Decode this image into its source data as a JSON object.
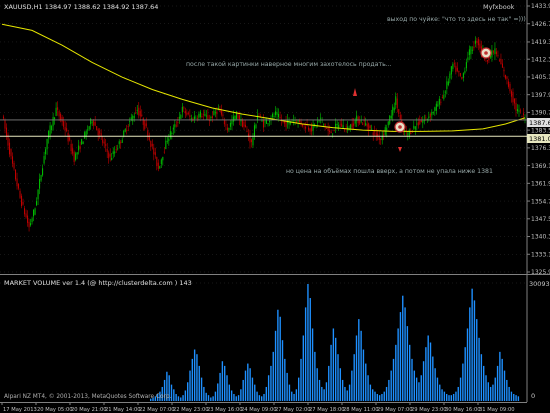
{
  "chart": {
    "title": "XAUUSD,H1  1384.97 1388.62 1384.92 1387.64",
    "brand": "Myfxbook",
    "price_ticks": [
      "1433.90",
      "1426.70",
      "1419.30",
      "1412.30",
      "1405.10",
      "1397.90",
      "1390.70",
      "1383.50",
      "1376.30",
      "1369.10",
      "1361.90",
      "1354.70",
      "1347.50",
      "1340.30",
      "1333.10",
      "1325.90"
    ],
    "current_price": "1387.64",
    "level_price": "1381.00",
    "annotations": {
      "top_right": "выход по чуйке: \"что то здесь не так\" =)))",
      "middle": "после такой картинки наверное многим захотелось продать...",
      "bottom": "но цена на объёмах пошла вверх, а потом не упала ниже 1381"
    },
    "colors": {
      "bull": "#00c000",
      "bear": "#c00000",
      "ma": "#e6e600",
      "level": "#e8e8c0",
      "volume": "#1e90ff",
      "background": "#000000",
      "grid": "#3a3a3a",
      "text": "#c0c0c0"
    }
  },
  "volume": {
    "title": "MARKET VOLUME ver 1.4 (@ http://clusterdelta.com ) 143",
    "max_label": "30093",
    "zero_label": "0",
    "footer": "Alpari NZ MT4, © 2001-2013, MetaQuotes Software Corp."
  },
  "time_axis": {
    "labels": [
      "17 May 2013",
      "20 May 05:00",
      "20 May 21:00",
      "21 May 14:00",
      "22 May 07:00",
      "22 May 23:00",
      "23 May 16:00",
      "24 May 09:00",
      "27 May 02:00",
      "27 May 18:00",
      "28 May 11:00",
      "29 May 07:00",
      "29 May 23:00",
      "30 May 16:00",
      "31 May 09:00"
    ]
  },
  "chart_data": {
    "type": "candlestick",
    "symbol": "XAUUSD",
    "timeframe": "H1",
    "ohlc_last": {
      "open": 1384.97,
      "high": 1388.62,
      "low": 1384.92,
      "close": 1387.64
    },
    "ylim": [
      1325.9,
      1433.9
    ],
    "close_path": [
      [
        0,
        1390
      ],
      [
        6,
        1372
      ],
      [
        12,
        1356
      ],
      [
        18,
        1344
      ],
      [
        22,
        1352
      ],
      [
        26,
        1366
      ],
      [
        30,
        1380
      ],
      [
        36,
        1392
      ],
      [
        42,
        1384
      ],
      [
        48,
        1372
      ],
      [
        54,
        1380
      ],
      [
        60,
        1388
      ],
      [
        66,
        1380
      ],
      [
        72,
        1372
      ],
      [
        78,
        1378
      ],
      [
        84,
        1386
      ],
      [
        90,
        1392
      ],
      [
        96,
        1384
      ],
      [
        100,
        1376
      ],
      [
        104,
        1368
      ],
      [
        110,
        1380
      ],
      [
        116,
        1386
      ],
      [
        120,
        1392
      ],
      [
        126,
        1388
      ],
      [
        132,
        1390
      ],
      [
        138,
        1388
      ],
      [
        144,
        1392
      ],
      [
        150,
        1384
      ],
      [
        156,
        1390
      ],
      [
        162,
        1384
      ],
      [
        166,
        1378
      ],
      [
        170,
        1390
      ],
      [
        174,
        1386
      ],
      [
        178,
        1388
      ],
      [
        182,
        1390
      ],
      [
        188,
        1386
      ],
      [
        194,
        1388
      ],
      [
        200,
        1386
      ],
      [
        206,
        1384
      ],
      [
        212,
        1388
      ],
      [
        218,
        1382
      ],
      [
        224,
        1386
      ],
      [
        230,
        1384
      ],
      [
        236,
        1388
      ],
      [
        242,
        1386
      ],
      [
        248,
        1382
      ],
      [
        252,
        1380
      ],
      [
        258,
        1388
      ],
      [
        262,
        1396
      ],
      [
        266,
        1384
      ],
      [
        270,
        1382
      ],
      [
        276,
        1386
      ],
      [
        282,
        1388
      ],
      [
        288,
        1392
      ],
      [
        294,
        1398
      ],
      [
        300,
        1410
      ],
      [
        306,
        1404
      ],
      [
        310,
        1414
      ],
      [
        316,
        1420
      ],
      [
        322,
        1412
      ],
      [
        328,
        1416
      ],
      [
        332,
        1410
      ],
      [
        338,
        1400
      ],
      [
        342,
        1392
      ],
      [
        348,
        1388
      ]
    ],
    "ma_path": [
      [
        0,
        1426.5
      ],
      [
        20,
        1424
      ],
      [
        40,
        1418
      ],
      [
        60,
        1411
      ],
      [
        80,
        1405
      ],
      [
        100,
        1400
      ],
      [
        120,
        1396
      ],
      [
        140,
        1392.5
      ],
      [
        160,
        1390
      ],
      [
        180,
        1388
      ],
      [
        200,
        1386
      ],
      [
        220,
        1384.5
      ],
      [
        240,
        1383.5
      ],
      [
        260,
        1383
      ],
      [
        280,
        1383
      ],
      [
        300,
        1383.2
      ],
      [
        320,
        1384
      ],
      [
        335,
        1386
      ],
      [
        348,
        1388.5
      ]
    ],
    "volume_values": [
      0.02,
      0.03,
      0.04,
      0.06,
      0.08,
      0.12,
      0.18,
      0.25,
      0.22,
      0.14,
      0.1,
      0.06,
      0.04,
      0.03,
      0.05,
      0.09,
      0.16,
      0.26,
      0.36,
      0.44,
      0.4,
      0.3,
      0.2,
      0.12,
      0.07,
      0.05,
      0.03,
      0.04,
      0.08,
      0.15,
      0.24,
      0.34,
      0.3,
      0.22,
      0.14,
      0.09,
      0.06,
      0.04,
      0.05,
      0.1,
      0.18,
      0.26,
      0.32,
      0.28,
      0.2,
      0.14,
      0.08,
      0.05,
      0.04,
      0.06,
      0.12,
      0.22,
      0.3,
      0.42,
      0.6,
      0.78,
      0.72,
      0.52,
      0.36,
      0.24,
      0.14,
      0.08,
      0.06,
      0.1,
      0.2,
      0.36,
      0.56,
      0.8,
      1.0,
      0.88,
      0.62,
      0.42,
      0.28,
      0.18,
      0.12,
      0.1,
      0.16,
      0.3,
      0.48,
      0.62,
      0.54,
      0.4,
      0.28,
      0.18,
      0.12,
      0.09,
      0.14,
      0.26,
      0.4,
      0.56,
      0.7,
      0.6,
      0.44,
      0.32,
      0.22,
      0.14,
      0.1,
      0.08,
      0.06,
      0.05,
      0.06,
      0.08,
      0.12,
      0.18,
      0.26,
      0.36,
      0.48,
      0.62,
      0.76,
      0.9,
      0.8,
      0.64,
      0.48,
      0.36,
      0.26,
      0.2,
      0.16,
      0.22,
      0.34,
      0.46,
      0.56,
      0.5,
      0.38,
      0.28,
      0.2,
      0.14,
      0.1,
      0.08,
      0.06,
      0.05,
      0.05,
      0.06,
      0.08,
      0.12,
      0.2,
      0.32,
      0.46,
      0.62,
      0.8,
      0.96,
      0.86,
      0.7,
      0.54,
      0.4,
      0.3,
      0.22,
      0.16,
      0.12,
      0.14,
      0.2,
      0.3,
      0.42,
      0.36,
      0.26,
      0.18,
      0.12,
      0.08,
      0.06,
      0.05,
      0.04
    ]
  }
}
